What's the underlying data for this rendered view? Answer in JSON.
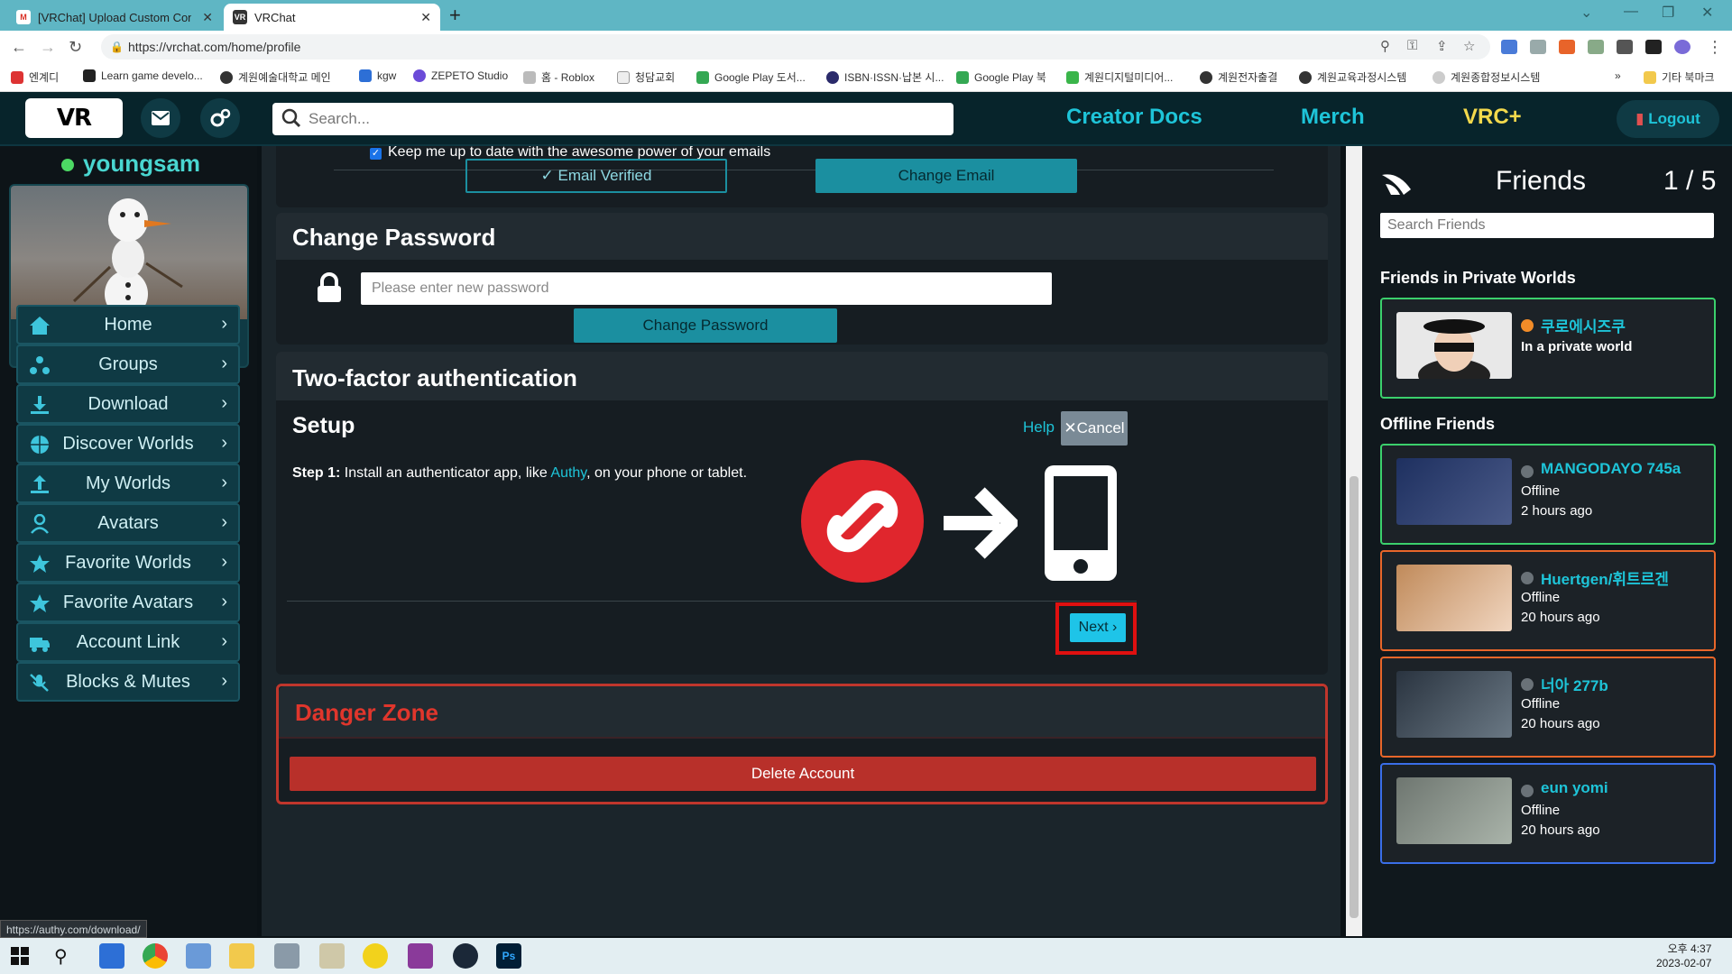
{
  "browser": {
    "tabs": [
      {
        "title": "[VRChat] Upload Custom Conte",
        "active": false
      },
      {
        "title": "VRChat",
        "active": true
      }
    ],
    "url": "https://vrchat.com/home/profile",
    "bookmarks": [
      "엔계디",
      "Learn game develo...",
      "계원예술대학교 메인",
      "kgw",
      "ZEPETO Studio",
      "홈 - Roblox",
      "청담교회",
      "Google Play 도서...",
      "ISBN·ISSN·납본 시...",
      "Google Play 북",
      "계원디지털미디어...",
      "계원전자출결",
      "계원교육과정시스템",
      "계원종합정보시스템",
      "기타 북마크"
    ],
    "bookmarks_overflow": "»"
  },
  "header": {
    "logo": "VR CHAT",
    "search_placeholder": "Search...",
    "links": [
      "Creator Docs",
      "Merch",
      "VRC+"
    ],
    "logout": "Logout"
  },
  "sidebar": {
    "username": "youngsam",
    "nav": [
      {
        "label": "Home",
        "icon": "home-icon"
      },
      {
        "label": "Groups",
        "icon": "groups-icon"
      },
      {
        "label": "Download",
        "icon": "download-icon"
      },
      {
        "label": "Discover Worlds",
        "icon": "globe-icon"
      },
      {
        "label": "My Worlds",
        "icon": "upload-icon"
      },
      {
        "label": "Avatars",
        "icon": "avatar-icon"
      },
      {
        "label": "Favorite Worlds",
        "icon": "star-icon"
      },
      {
        "label": "Favorite Avatars",
        "icon": "star-icon"
      },
      {
        "label": "Account Link",
        "icon": "truck-icon"
      },
      {
        "label": "Blocks & Mutes",
        "icon": "mute-icon"
      }
    ]
  },
  "email_section": {
    "checkbox_label": "Keep me up to date with the awesome power of your emails",
    "checked": true,
    "verified_label": "Email Verified",
    "change_email_label": "Change Email"
  },
  "password_section": {
    "title": "Change Password",
    "placeholder": "Please enter new password",
    "button": "Change Password"
  },
  "tfa_section": {
    "title": "Two-factor authentication",
    "setup_title": "Setup",
    "help": "Help",
    "cancel": "Cancel",
    "step_label": "Step 1:",
    "step_text_before": " Install an authenticator app, like ",
    "step_link": "Authy",
    "step_text_after": ", on your phone or tablet.",
    "next": "Next"
  },
  "danger_section": {
    "title": "Danger Zone",
    "delete_button": "Delete Account"
  },
  "friends": {
    "title": "Friends",
    "count": "1 / 5",
    "search_placeholder": "Search Friends",
    "private_section": "Friends in Private Worlds",
    "offline_section": "Offline Friends",
    "private": [
      {
        "name": "쿠로에시즈쿠",
        "status": "In a private world",
        "dot_color": "#f28c28",
        "border": "#3bd06c"
      }
    ],
    "offline": [
      {
        "name": "MANGODAYO 745a",
        "status": "Offline",
        "ago": "2 hours ago",
        "border": "#3bd06c"
      },
      {
        "name": "Huertgen/휘트르겐",
        "status": "Offline",
        "ago": "20 hours ago",
        "border": "#e8662a"
      },
      {
        "name": "너아 277b",
        "status": "Offline",
        "ago": "20 hours ago",
        "border": "#e8662a"
      },
      {
        "name": "eun yomi",
        "status": "Offline",
        "ago": "20 hours ago",
        "border": "#3a6ee8"
      }
    ]
  },
  "status_url": "https://authy.com/download/",
  "clock": {
    "time": "오후 4:37",
    "date": "2023-02-07"
  },
  "colors": {
    "accent": "#1ec4d8",
    "danger": "#c0362c",
    "highlight_box": "#e01010"
  }
}
